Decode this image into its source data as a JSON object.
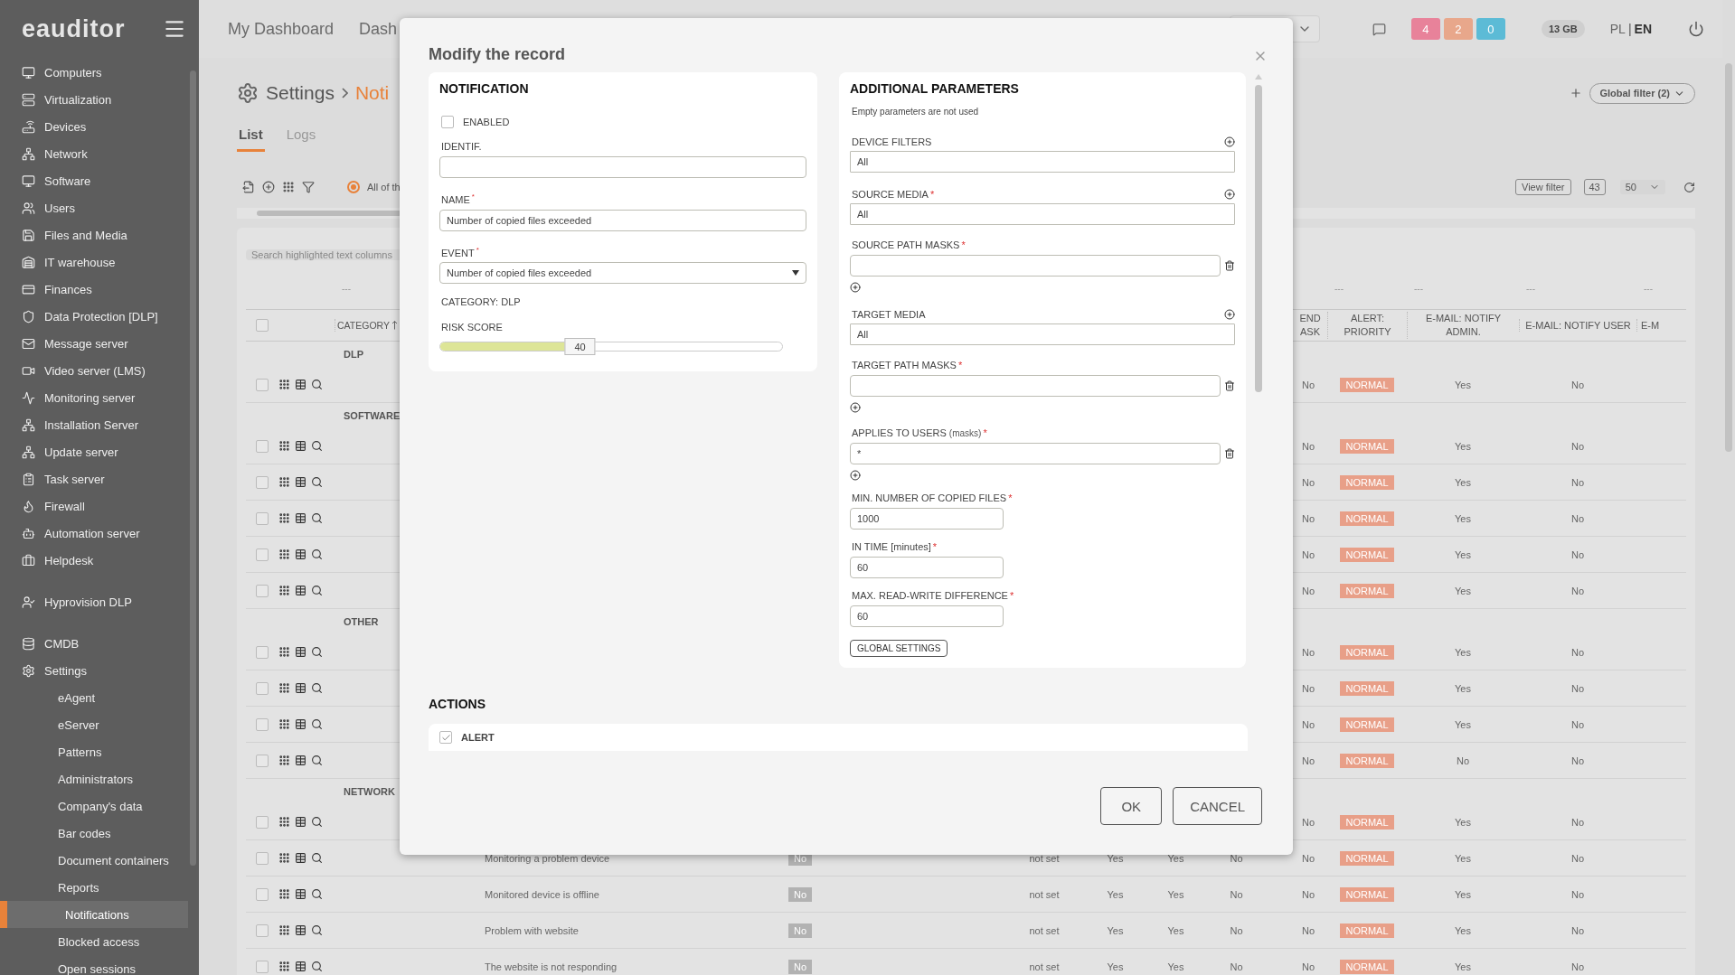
{
  "sidebar": {
    "logo": "eauditor",
    "sections": [
      [
        {
          "label": "Computers",
          "selected": false
        },
        {
          "label": "Virtualization",
          "selected": false
        },
        {
          "label": "Devices",
          "selected": false
        },
        {
          "label": "Network",
          "selected": false
        },
        {
          "label": "Software",
          "selected": false
        },
        {
          "label": "Users",
          "selected": false
        },
        {
          "label": "Files and Media",
          "selected": false
        },
        {
          "label": "IT warehouse",
          "selected": false
        },
        {
          "label": "Finances",
          "selected": false
        },
        {
          "label": "Data Protection [DLP]",
          "selected": false
        },
        {
          "label": "Message server",
          "selected": false
        },
        {
          "label": "Video server (LMS)",
          "selected": false
        },
        {
          "label": "Monitoring server",
          "selected": false
        },
        {
          "label": "Installation Server",
          "selected": false
        },
        {
          "label": "Update server",
          "selected": false
        },
        {
          "label": "Task server",
          "selected": false
        },
        {
          "label": "Firewall",
          "selected": false
        },
        {
          "label": "Automation server",
          "selected": false
        },
        {
          "label": "Helpdesk",
          "selected": false
        }
      ],
      [
        {
          "label": "Hyprovision DLP",
          "selected": false
        }
      ],
      [
        {
          "label": "CMDB",
          "selected": false
        },
        {
          "label": "Settings",
          "selected": false,
          "children": [
            {
              "label": "eAgent",
              "selected": false
            },
            {
              "label": "eServer",
              "selected": false
            },
            {
              "label": "Patterns",
              "selected": false
            },
            {
              "label": "Administrators",
              "selected": false
            },
            {
              "label": "Company's data",
              "selected": false
            },
            {
              "label": "Bar codes",
              "selected": false
            },
            {
              "label": "Document containers",
              "selected": false
            },
            {
              "label": "Reports",
              "selected": false
            },
            {
              "label": "Notifications",
              "selected": true
            },
            {
              "label": "Blocked access",
              "selected": false
            },
            {
              "label": "Open sessions",
              "selected": false
            }
          ]
        }
      ]
    ]
  },
  "topbar": {
    "links": [
      "My Dashboard",
      "Dash"
    ],
    "alerts": [
      {
        "text": "4",
        "color": "#e8829a"
      },
      {
        "text": "2",
        "color": "#e8a78b"
      },
      {
        "text": "0",
        "color": "#5cbbd6"
      }
    ],
    "storage": "13 GB",
    "separator": "|",
    "languages": [
      {
        "label": "PL",
        "selected": false
      },
      {
        "label": "EN",
        "selected": true
      }
    ]
  },
  "page": {
    "title": "Settings",
    "breadcrumb": "Noti",
    "tabs": [
      {
        "label": "List",
        "selected": true
      },
      {
        "label": "Logs",
        "selected": false
      }
    ],
    "filter_option": {
      "label": "All of th",
      "selected": true
    },
    "global_filter": "Global filter (2)",
    "view_filter": "View filter",
    "count": "43",
    "page_size": "50",
    "search": {
      "placeholder": "Search highlighted text columns"
    }
  },
  "table": {
    "all_checked": false,
    "filter_marks": {
      "category": "---",
      "alert_priority": "---",
      "email_notify_admin": "---",
      "email_notify_user": "---",
      "column_e": "---"
    },
    "columns": {
      "category": "CATEGORY",
      "end_task": "END ASK",
      "alert_priority": "ALERT: PRIORITY",
      "email_notify_admin": "E-MAIL: NOTIFY ADMIN.",
      "email_notify_user": "E-MAIL: NOTIFY USER",
      "column_e": "E-M"
    },
    "groups": [
      {
        "label": "DLP",
        "rows": [
          {
            "checked": false,
            "end_task": "No",
            "alert_priority": "NORMAL",
            "email_notify_admin": "Yes",
            "email_notify_user": "No"
          }
        ]
      },
      {
        "label": "SOFTWARE",
        "rows": [
          {
            "checked": false,
            "end_task": "No",
            "alert_priority": "NORMAL",
            "email_notify_admin": "Yes",
            "email_notify_user": "No"
          },
          {
            "checked": false,
            "end_task": "No",
            "alert_priority": "NORMAL",
            "email_notify_admin": "Yes",
            "email_notify_user": "No"
          },
          {
            "checked": false,
            "end_task": "No",
            "alert_priority": "NORMAL",
            "email_notify_admin": "Yes",
            "email_notify_user": "No"
          },
          {
            "checked": false,
            "end_task": "No",
            "alert_priority": "NORMAL",
            "email_notify_admin": "Yes",
            "email_notify_user": "No"
          },
          {
            "checked": false,
            "end_task": "No",
            "alert_priority": "NORMAL",
            "email_notify_admin": "Yes",
            "email_notify_user": "No"
          }
        ]
      },
      {
        "label": "OTHER",
        "rows": [
          {
            "checked": false,
            "end_task": "No",
            "alert_priority": "NORMAL",
            "email_notify_admin": "Yes",
            "email_notify_user": "No"
          },
          {
            "checked": false,
            "end_task": "No",
            "alert_priority": "NORMAL",
            "email_notify_admin": "Yes",
            "email_notify_user": "No"
          },
          {
            "checked": false,
            "end_task": "No",
            "alert_priority": "NORMAL",
            "email_notify_admin": "Yes",
            "email_notify_user": "No"
          },
          {
            "checked": false,
            "end_task": "No",
            "alert_priority": "NORMAL",
            "email_notify_admin": "No",
            "email_notify_user": "No"
          }
        ]
      },
      {
        "label": "NETWORK",
        "rows": [
          {
            "checked": false,
            "end_task": "No",
            "alert_priority": "NORMAL",
            "email_notify_admin": "Yes",
            "email_notify_user": "No"
          },
          {
            "checked": false,
            "column_4": "Monitoring a problem device",
            "column_5": "No",
            "column_6": "not set",
            "column_7": "Yes",
            "column_8": "Yes",
            "column_9": "No",
            "end_task": "No",
            "alert_priority": "NORMAL",
            "email_notify_admin": "Yes",
            "email_notify_user": "No"
          },
          {
            "checked": false,
            "column_4": "Monitored device is offline",
            "column_5": "No",
            "column_6": "not set",
            "column_7": "Yes",
            "column_8": "Yes",
            "column_9": "No",
            "end_task": "No",
            "alert_priority": "NORMAL",
            "email_notify_admin": "Yes",
            "email_notify_user": "No"
          },
          {
            "checked": false,
            "column_4": "Problem with website",
            "column_5": "No",
            "column_6": "not set",
            "column_7": "Yes",
            "column_8": "Yes",
            "column_9": "No",
            "end_task": "No",
            "alert_priority": "NORMAL",
            "email_notify_admin": "Yes",
            "email_notify_user": "No"
          },
          {
            "checked": false,
            "column_4": "The website is not responding",
            "column_5": "No",
            "column_6": "not set",
            "column_7": "Yes",
            "column_8": "Yes",
            "column_9": "No",
            "end_task": "No",
            "alert_priority": "NORMAL",
            "email_notify_admin": "Yes",
            "email_notify_user": "No"
          }
        ]
      }
    ]
  },
  "modal": {
    "title": "Modify the record",
    "notification": {
      "heading": "NOTIFICATION",
      "enabled": {
        "label": "ENABLED",
        "checked": false
      },
      "identif": {
        "label": "IDENTIF."
      },
      "name": {
        "label": "NAME",
        "mark": "*",
        "value": "Number of copied files exceeded"
      },
      "event": {
        "label": "EVENT",
        "mark": "*",
        "value": "Number of copied files exceeded"
      },
      "category": "CATEGORY: DLP",
      "risk_score": {
        "label": "RISK SCORE",
        "level": 0.4,
        "value": "40"
      }
    },
    "additional": {
      "heading": "ADDITIONAL PARAMETERS",
      "note": "Empty parameters are not used",
      "fields": [
        {
          "kind": "list",
          "label": "DEVICE FILTERS",
          "value": "All"
        },
        {
          "kind": "list",
          "label": "SOURCE MEDIA",
          "mark": "*",
          "value": "All"
        },
        {
          "kind": "mask",
          "label": "SOURCE PATH MASKS",
          "mark": "*"
        },
        {
          "kind": "list",
          "label": "TARGET MEDIA",
          "value": "All"
        },
        {
          "kind": "mask",
          "label": "TARGET PATH MASKS",
          "mark": "*"
        },
        {
          "kind": "mask",
          "label": "APPLIES TO USERS",
          "hint": "(masks)",
          "mark": "*",
          "value": "*"
        },
        {
          "kind": "number",
          "label": "MIN. NUMBER OF COPIED FILES",
          "mark": "*",
          "value": "1000"
        },
        {
          "kind": "number",
          "label": "IN TIME [minutes]",
          "mark": "*",
          "value": "60"
        },
        {
          "kind": "number",
          "label": "MAX. READ-WRITE DIFFERENCE",
          "mark": "*",
          "value": "60"
        }
      ],
      "button": "GLOBAL SETTINGS"
    },
    "actions": {
      "heading": "ACTIONS",
      "items": [
        {
          "label": "ALERT",
          "checked": true
        }
      ]
    },
    "buttons": [
      "OK",
      "CANCEL"
    ]
  }
}
